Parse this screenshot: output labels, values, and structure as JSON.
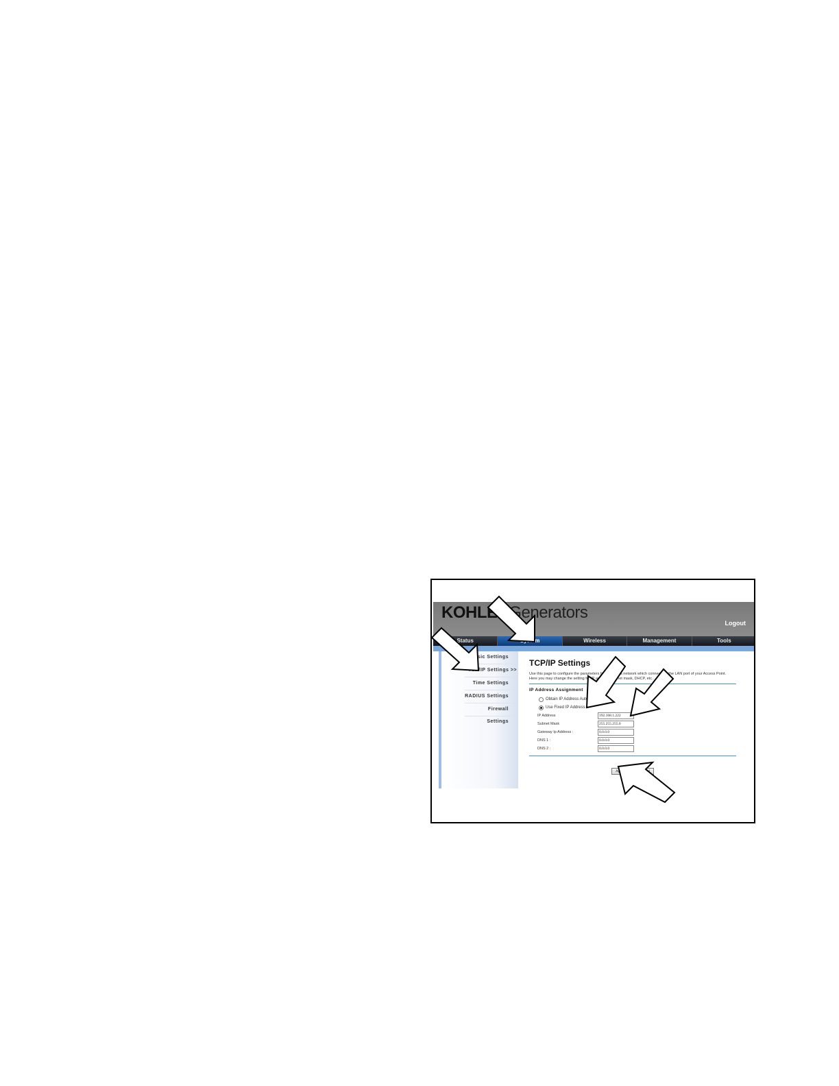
{
  "app": {
    "brand": "KOHLER",
    "brand_rest": "Generators",
    "logout_label": "Logout"
  },
  "nav": {
    "tabs": [
      {
        "label": "Status"
      },
      {
        "label": "System",
        "active": true
      },
      {
        "label": "Wireless"
      },
      {
        "label": "Management"
      },
      {
        "label": "Tools"
      }
    ]
  },
  "sidebar": {
    "items": [
      {
        "label": "Basic Settings"
      },
      {
        "label": "TCP/IP Settings  >>",
        "active": true
      },
      {
        "label": "Time Settings"
      },
      {
        "label": "RADIUS Settings"
      },
      {
        "label": "Firewall Settings"
      }
    ]
  },
  "main": {
    "title": "TCP/IP Settings",
    "description": "Use this page to configure the parameters for local area network which connects to the LAN port of your Access Point. Here you may change the setting for IP address, subnet mask, DHCP, etc..",
    "section_title": "IP Address Assignment",
    "radio_auto": "Obtain IP Address Automatically",
    "radio_fixed": "Use Fixed IP Address",
    "fields": [
      {
        "label": "IP Address",
        "value": "192.168.1.222"
      },
      {
        "label": "Subnet Mask",
        "value": "255.255.255.0"
      },
      {
        "label": "Gateway Ip Address :",
        "value": "0.0.0.0"
      },
      {
        "label": "DNS 1 :",
        "value": "0.0.0.0"
      },
      {
        "label": "DNS 2 :",
        "value": "0.0.0.0"
      }
    ],
    "apply_label": "Apply",
    "cancel_label": "Cancel"
  }
}
